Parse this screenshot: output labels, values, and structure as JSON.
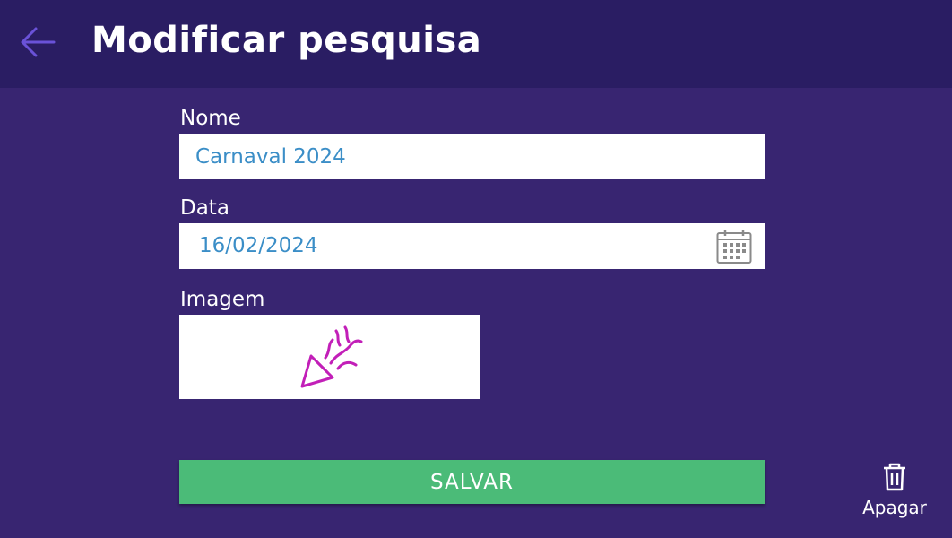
{
  "header": {
    "title": "Modificar pesquisa",
    "back_icon": "arrow-left-icon"
  },
  "form": {
    "name_label": "Nome",
    "name_value": "Carnaval 2024",
    "date_label": "Data",
    "date_value": "16/02/2024",
    "date_icon": "calendar-icon",
    "image_label": "Imagem",
    "image_icon": "party-popper-icon"
  },
  "actions": {
    "save_label": "SALVAR",
    "delete_label": "Apagar",
    "delete_icon": "trash-icon"
  },
  "colors": {
    "background": "#382571",
    "header": "#2a1d63",
    "accent": "#6a52d8",
    "field_text": "#3b8ec7",
    "save_button": "#4bbb78",
    "image_icon": "#c21fb8"
  }
}
